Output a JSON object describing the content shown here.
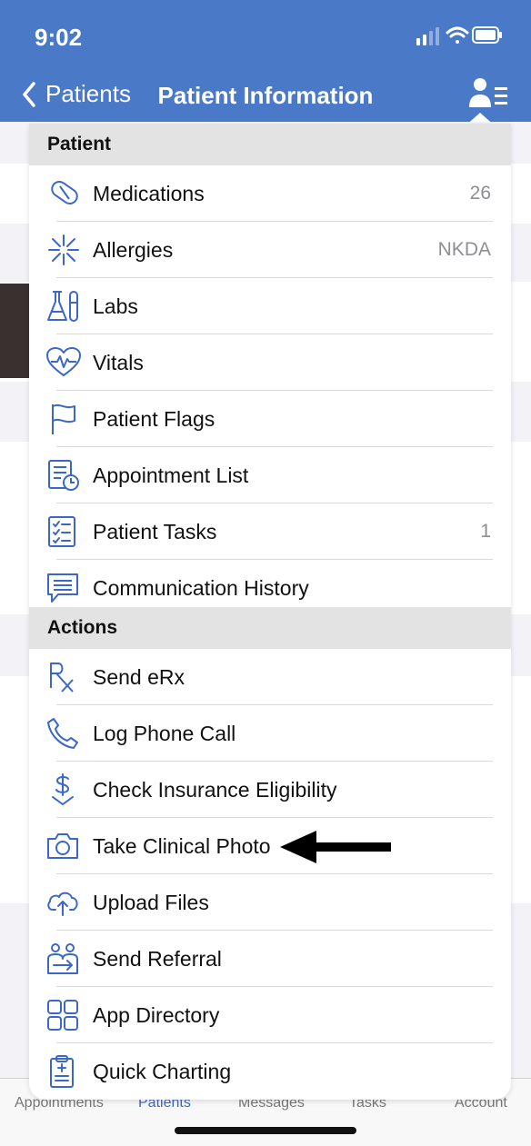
{
  "status_bar": {
    "time": "9:02"
  },
  "nav": {
    "back_label": "Patients",
    "title": "Patient Information"
  },
  "menu": {
    "sections": [
      {
        "title": "Patient",
        "items": [
          {
            "label": "Medications",
            "value": "26",
            "icon": "pill-icon"
          },
          {
            "label": "Allergies",
            "value": "NKDA",
            "icon": "allergy-burst-icon"
          },
          {
            "label": "Labs",
            "value": "",
            "icon": "lab-flask-icon"
          },
          {
            "label": "Vitals",
            "value": "",
            "icon": "heart-pulse-icon"
          },
          {
            "label": "Patient Flags",
            "value": "",
            "icon": "flag-icon"
          },
          {
            "label": "Appointment List",
            "value": "",
            "icon": "appointment-list-icon"
          },
          {
            "label": "Patient Tasks",
            "value": "1",
            "icon": "task-checklist-icon"
          },
          {
            "label": "Communication History",
            "value": "",
            "icon": "chat-history-icon"
          }
        ]
      },
      {
        "title": "Actions",
        "items": [
          {
            "label": "Send eRx",
            "value": "",
            "icon": "rx-icon"
          },
          {
            "label": "Log Phone Call",
            "value": "",
            "icon": "phone-icon"
          },
          {
            "label": "Check Insurance Eligibility",
            "value": "",
            "icon": "dollar-check-icon"
          },
          {
            "label": "Take Clinical Photo",
            "value": "",
            "icon": "camera-icon"
          },
          {
            "label": "Upload Files",
            "value": "",
            "icon": "cloud-upload-icon"
          },
          {
            "label": "Send Referral",
            "value": "",
            "icon": "referral-icon"
          },
          {
            "label": "App Directory",
            "value": "",
            "icon": "app-grid-icon"
          },
          {
            "label": "Quick Charting",
            "value": "",
            "icon": "clipboard-icon"
          }
        ]
      }
    ]
  },
  "tabbar": {
    "tabs": [
      {
        "label": "Appointments",
        "active": false
      },
      {
        "label": "Patients",
        "active": true
      },
      {
        "label": "Messages",
        "active": false
      },
      {
        "label": "Tasks",
        "active": false
      },
      {
        "label": "Account",
        "active": false
      }
    ]
  },
  "colors": {
    "header": "#4a79c7",
    "icon": "#3b67c9",
    "active_tab": "#3b67c9"
  }
}
